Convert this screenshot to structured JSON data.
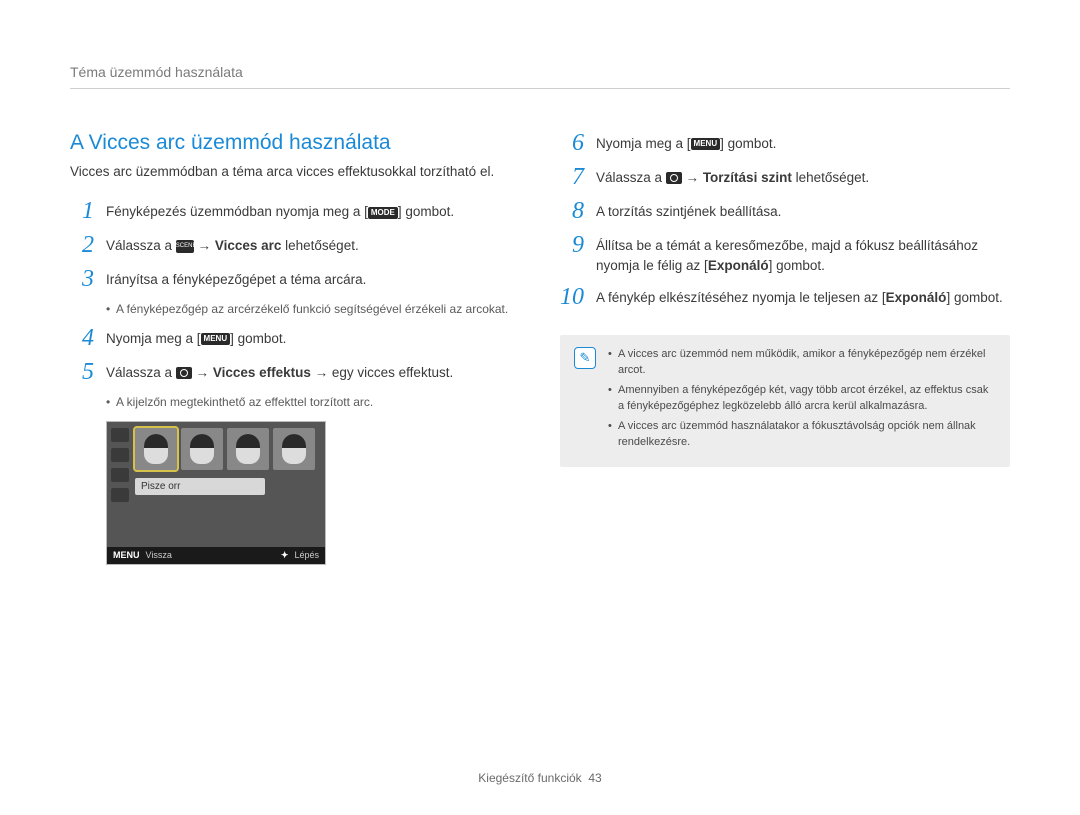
{
  "breadcrumb": "Téma üzemmód használata",
  "section_title": "A Vicces arc üzemmód használata",
  "intro": "Vicces arc üzemmódban a téma arca vicces effektusokkal torzítható el.",
  "left_steps": [
    {
      "n": "1",
      "text_pre": "Fényképezés üzemmódban nyomja meg a [",
      "button": "MODE",
      "text_post": "] gombot."
    },
    {
      "n": "2",
      "text_pre": "Válassza a ",
      "icon": "scene",
      "arrow": " → ",
      "bold": "Vicces arc",
      "text_post": " lehetőséget."
    },
    {
      "n": "3",
      "text_pre": "Irányítsa a fényképezőgépet a téma arcára.",
      "sub": [
        "A fényképezőgép az arcérzékelő funkció segítségével érzékeli az arcokat."
      ]
    },
    {
      "n": "4",
      "text_pre": "Nyomja meg a [",
      "button": "MENU",
      "text_post": "] gombot."
    },
    {
      "n": "5",
      "text_pre": "Válassza a ",
      "icon": "camera",
      "arrow": " → ",
      "bold": "Vicces effektus",
      "arrow2": " → ",
      "text_post": "egy vicces effektust.",
      "sub": [
        "A kijelzőn megtekinthető az effekttel torzított arc."
      ]
    }
  ],
  "lcd": {
    "label": "Pisze orr",
    "bar_menu_key": "MENU",
    "bar_back": "Vissza",
    "bar_step_key": "✦",
    "bar_step": "Lépés"
  },
  "right_steps": [
    {
      "n": "6",
      "text_pre": "Nyomja meg a [",
      "button": "MENU",
      "text_post": "] gombot."
    },
    {
      "n": "7",
      "text_pre": "Válassza a ",
      "icon": "camera",
      "arrow": " → ",
      "bold": "Torzítási szint",
      "text_post": " lehetőséget."
    },
    {
      "n": "8",
      "text_pre": "A torzítás szintjének beállítása."
    },
    {
      "n": "9",
      "text_pre": "Állítsa be a témát a keresőmezőbe, majd a fókusz beállításához nyomja le félig az [",
      "bold2": "Exponáló",
      "text_post": "] gombot."
    },
    {
      "n": "10",
      "text_pre": "A fénykép elkészítéséhez nyomja le teljesen az [",
      "bold2": "Exponáló",
      "text_post": "] gombot."
    }
  ],
  "note": [
    "A vicces arc üzemmód nem működik, amikor a fényképezőgép nem érzékel arcot.",
    "Amennyiben a fényképezőgép két, vagy több arcot érzékel, az effektus csak a fényképezőgéphez legközelebb álló arcra kerül alkalmazásra.",
    "A vicces arc üzemmód használatakor a fókusztávolság opciók nem állnak rendelkezésre."
  ],
  "footer_label": "Kiegészítő funkciók",
  "footer_page": "43"
}
